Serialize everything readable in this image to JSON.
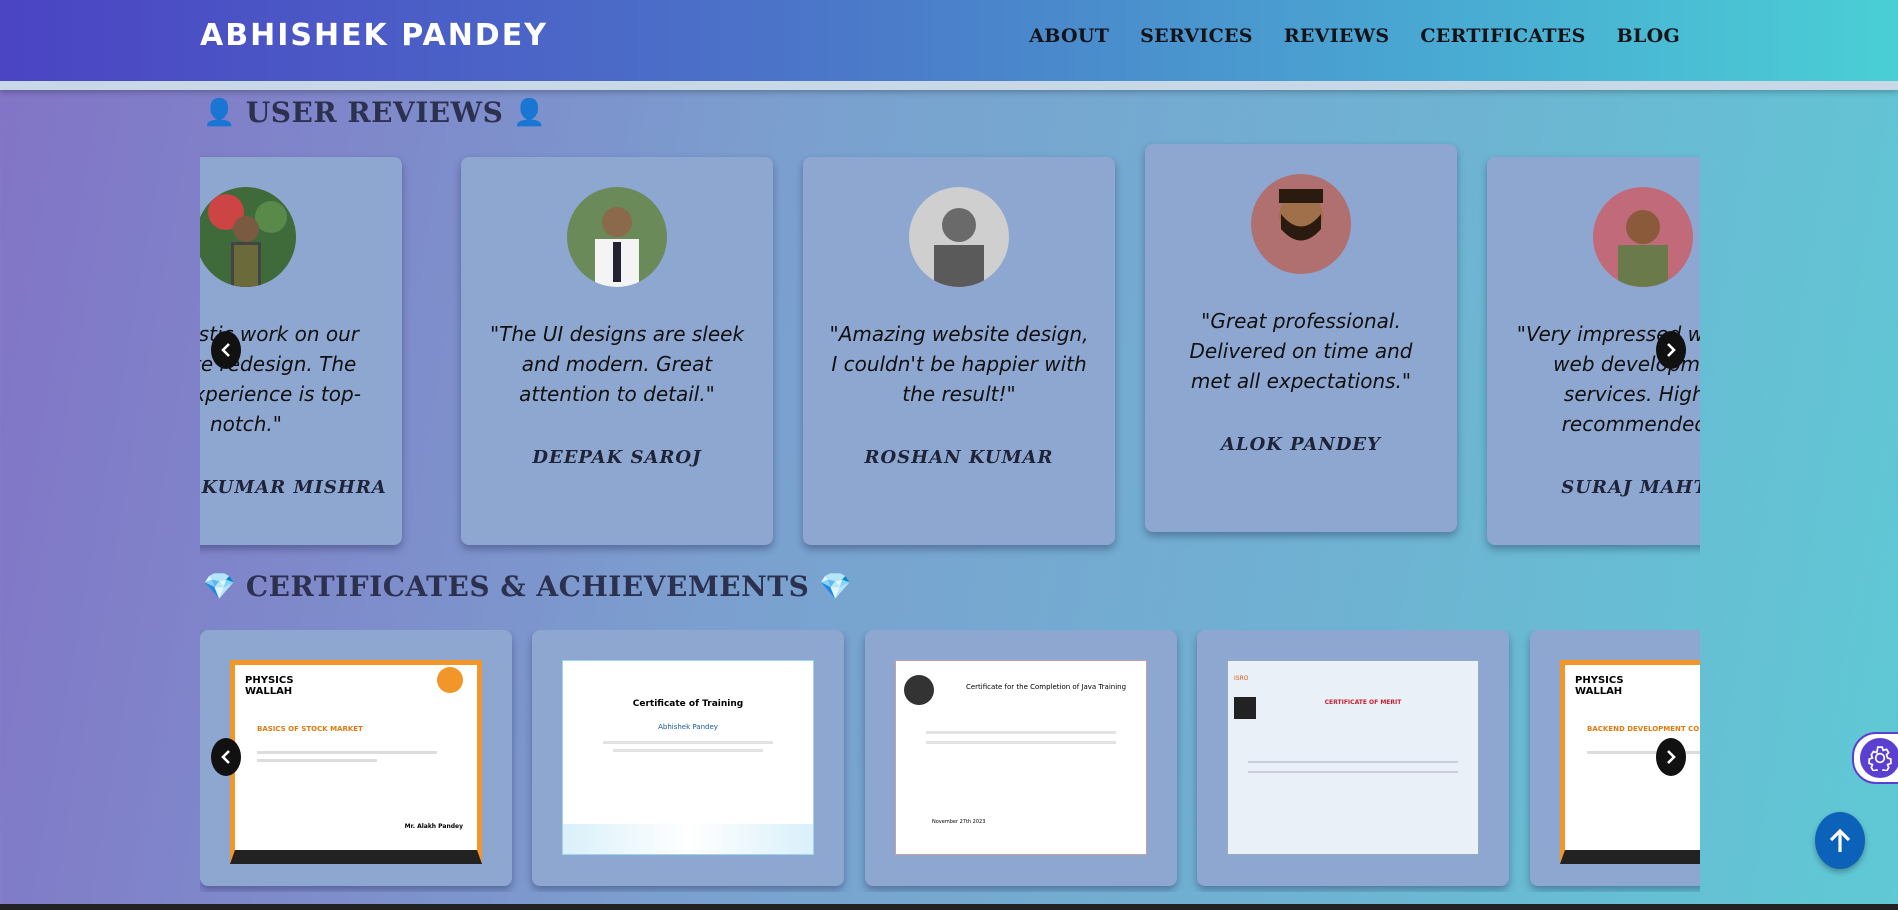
{
  "brand": "ABHISHEK PANDEY",
  "nav": {
    "about": "ABOUT",
    "services": "SERVICES",
    "reviews": "REVIEWS",
    "certificates": "CERTIFICATES",
    "blog": "BLOG"
  },
  "reviews_section": {
    "title": "USER REVIEWS",
    "icon": "person-icon",
    "reviews": [
      {
        "quote": "\"Fantastic work on our website redesign. The user experience is top-notch.\"",
        "name": "SACHIN KUMAR MISHRA"
      },
      {
        "quote": "\"The UI designs are sleek and modern. Great attention to detail.\"",
        "name": "DEEPAK SAROJ"
      },
      {
        "quote": "\"Amazing website design, I couldn't be happier with the result!\"",
        "name": "ROSHAN KUMAR"
      },
      {
        "quote": "\"Great professional. Delivered on time and met all expectations.\"",
        "name": "ALOK PANDEY"
      },
      {
        "quote": "\"Very impressed with the web development services. Highly recommended!\"",
        "name": "SURAJ MAHTO"
      }
    ]
  },
  "certificates_section": {
    "title": "CERTIFICATES & ACHIEVEMENTS",
    "icon": "gem-icon",
    "certs": [
      {
        "issuer": "PHYSICS WALLAH",
        "course": "BASICS OF STOCK MARKET",
        "signer": "Mr. Alakh Pandey"
      },
      {
        "issuer": "",
        "course": "Certificate of Training",
        "recipient": "Abhishek Pandey"
      },
      {
        "issuer": "",
        "course": "Certificate for the Completion of Java Training",
        "date": "November 27th 2023"
      },
      {
        "issuer": "ISRO",
        "course": "CERTIFICATE OF MERIT"
      },
      {
        "issuer": "PHYSICS WALLAH",
        "course": "BACKEND DEVELOPMENT COURSE"
      }
    ]
  },
  "colors": {
    "accent": "#5a3fd0",
    "card": "#8ea7d1",
    "scroll_top": "#0b62b8",
    "pw_orange": "#f3962a"
  }
}
